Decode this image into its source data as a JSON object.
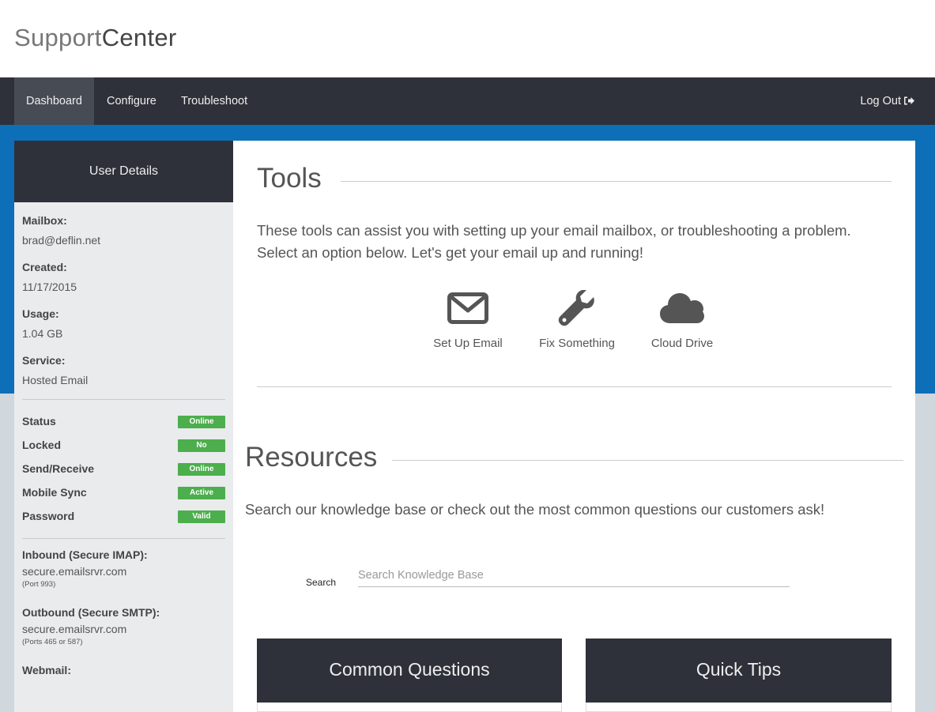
{
  "brand": {
    "part1": "Support",
    "part2": "Center"
  },
  "nav": {
    "items": [
      {
        "label": "Dashboard",
        "active": true
      },
      {
        "label": "Configure",
        "active": false
      },
      {
        "label": "Troubleshoot",
        "active": false
      }
    ],
    "logout_label": "Log Out"
  },
  "sidebar": {
    "title": "User Details",
    "mailbox": {
      "label": "Mailbox:",
      "value": "brad@deflin.net"
    },
    "created": {
      "label": "Created:",
      "value": "11/17/2015"
    },
    "usage": {
      "label": "Usage:",
      "value": "1.04 GB"
    },
    "service": {
      "label": "Service:",
      "value": "Hosted Email"
    },
    "statuses": [
      {
        "label": "Status",
        "badge": "Online"
      },
      {
        "label": "Locked",
        "badge": "No"
      },
      {
        "label": "Send/Receive",
        "badge": "Online"
      },
      {
        "label": "Mobile Sync",
        "badge": "Active"
      },
      {
        "label": "Password",
        "badge": "Valid"
      }
    ],
    "badge_color": "#4cae4c",
    "inbound": {
      "label": "Inbound (Secure IMAP):",
      "value": "secure.emailsrvr.com",
      "note": "(Port 993)"
    },
    "outbound": {
      "label": "Outbound (Secure SMTP):",
      "value": "secure.emailsrvr.com",
      "note": "(Ports 465 or 587)"
    },
    "webmail": {
      "label": "Webmail:"
    }
  },
  "tools": {
    "title": "Tools",
    "intro": "These tools can assist you with setting up your email mailbox, or troubleshooting a problem. Select an option below. Let's get your email up and running!",
    "items": [
      {
        "label": "Set Up Email",
        "icon": "envelope-icon"
      },
      {
        "label": "Fix Something",
        "icon": "wrench-icon"
      },
      {
        "label": "Cloud Drive",
        "icon": "cloud-icon"
      }
    ]
  },
  "resources": {
    "title": "Resources",
    "intro": "Search our knowledge base or check out the most common questions our customers ask!",
    "search_label": "Search",
    "search_placeholder": "Search Knowledge Base",
    "search_value": "",
    "cards": [
      {
        "title": "Common Questions"
      },
      {
        "title": "Quick Tips"
      }
    ]
  },
  "colors": {
    "nav_bg": "#2e3139",
    "accent_blue": "#0d6fb8",
    "page_bg": "#d0d7dd"
  }
}
